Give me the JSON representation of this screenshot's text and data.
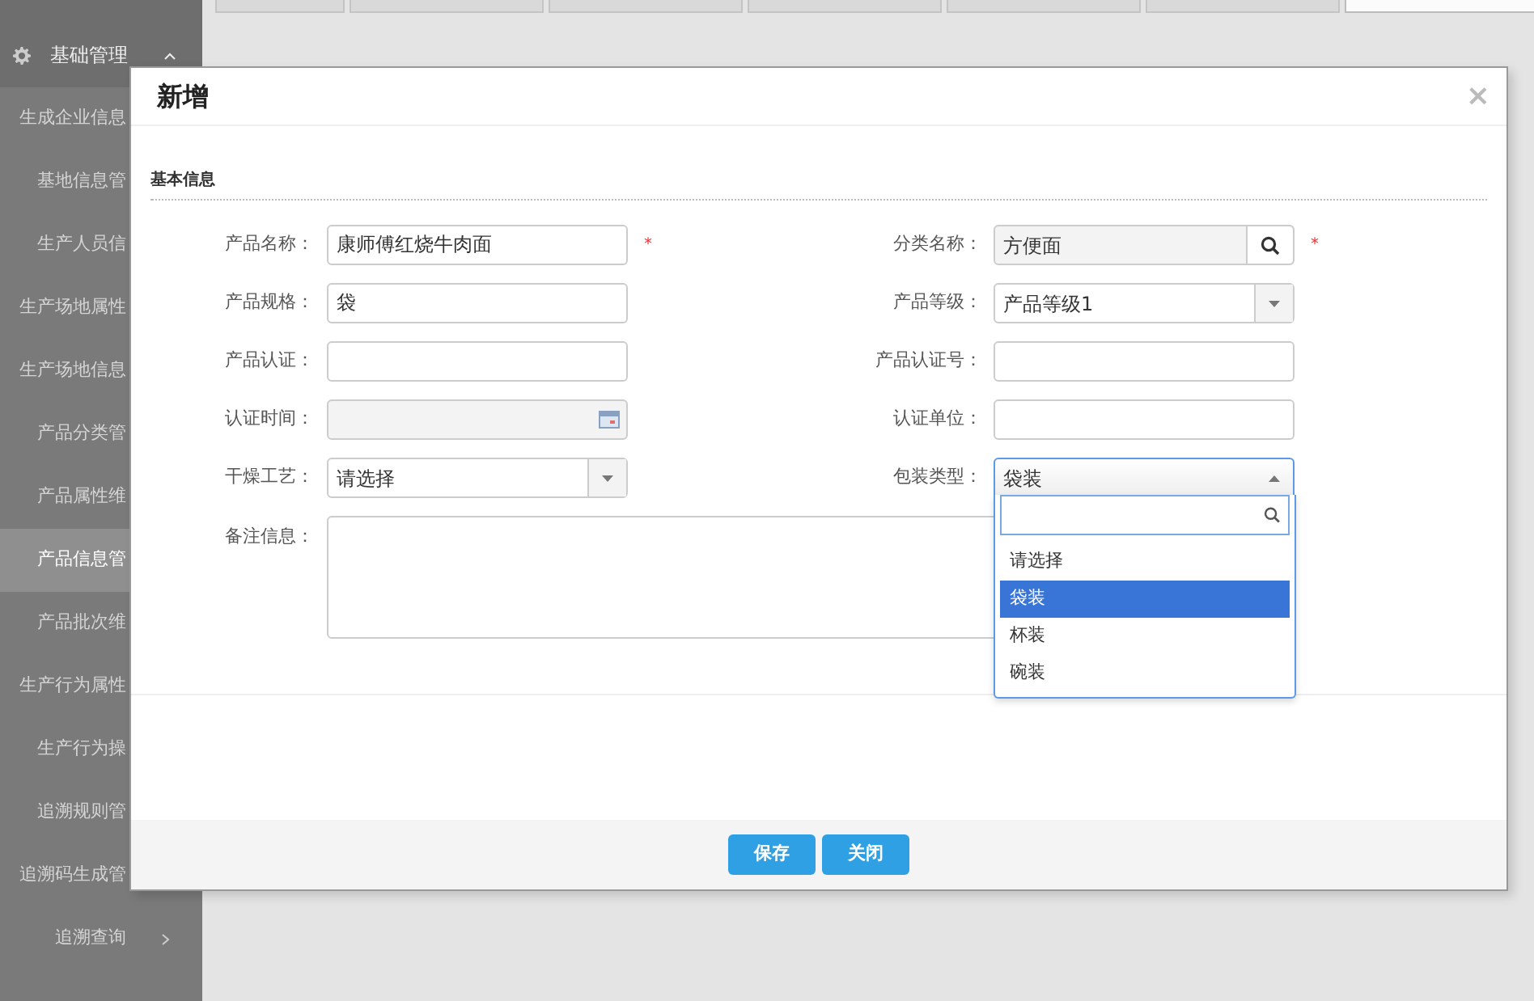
{
  "tabs": [
    {
      "selected": false
    },
    {
      "selected": false
    },
    {
      "selected": false
    },
    {
      "selected": false
    },
    {
      "selected": false
    },
    {
      "selected": false
    },
    {
      "selected": true
    }
  ],
  "sidebar": {
    "header": {
      "label": "基础管理",
      "expanded": true
    },
    "items": [
      {
        "label": "生成企业信息",
        "kind": "link",
        "selected": false
      },
      {
        "label": "基地信息管",
        "kind": "link",
        "selected": false
      },
      {
        "label": "生产人员信",
        "kind": "link",
        "selected": false
      },
      {
        "label": "生产场地属性",
        "kind": "link",
        "selected": false
      },
      {
        "label": "生产场地信息",
        "kind": "link",
        "selected": false
      },
      {
        "label": "产品分类管",
        "kind": "link",
        "selected": false
      },
      {
        "label": "产品属性维",
        "kind": "link",
        "selected": false
      },
      {
        "label": "产品信息管",
        "kind": "link",
        "selected": true
      },
      {
        "label": "产品批次维",
        "kind": "link",
        "selected": false
      },
      {
        "label": "生产行为属性",
        "kind": "link",
        "selected": false
      },
      {
        "label": "生产行为操",
        "kind": "link",
        "selected": false
      },
      {
        "label": "追溯规则管",
        "kind": "link",
        "selected": false
      },
      {
        "label": "追溯码生成管",
        "kind": "link",
        "selected": false
      },
      {
        "label": "追溯查询",
        "kind": "group",
        "selected": false
      }
    ]
  },
  "dialog": {
    "title": "新增",
    "close": "×",
    "section": "基本信息",
    "rows": [
      [
        {
          "label": "产品名称：",
          "kind": "text",
          "value": "康师傅红烧牛肉面",
          "required_mark": "*"
        },
        {
          "label": "分类名称：",
          "kind": "search",
          "value": "方便面",
          "readonly": true,
          "required_mark": "*"
        }
      ],
      [
        {
          "label": "产品规格：",
          "kind": "text",
          "value": "袋"
        },
        {
          "label": "产品等级：",
          "kind": "select",
          "value": "产品等级1"
        }
      ],
      [
        {
          "label": "产品认证：",
          "kind": "text"
        },
        {
          "label": "产品认证号：",
          "kind": "text"
        }
      ],
      [
        {
          "label": "认证时间：",
          "kind": "date",
          "readonly": true
        },
        {
          "label": "认证单位：",
          "kind": "text"
        }
      ],
      [
        {
          "label": "干燥工艺：",
          "kind": "select",
          "value": "请选择"
        },
        {
          "label": "包装类型：",
          "kind": "select",
          "value": "袋装",
          "open": true
        }
      ],
      [
        {
          "label": "备注信息：",
          "kind": "textarea"
        }
      ]
    ],
    "dropdown": {
      "options": [
        {
          "label": "请选择",
          "selected": false
        },
        {
          "label": "袋装",
          "selected": true
        },
        {
          "label": "杯装",
          "selected": false
        },
        {
          "label": "碗装",
          "selected": false
        }
      ]
    },
    "buttons": [
      "保存",
      "关闭"
    ]
  }
}
